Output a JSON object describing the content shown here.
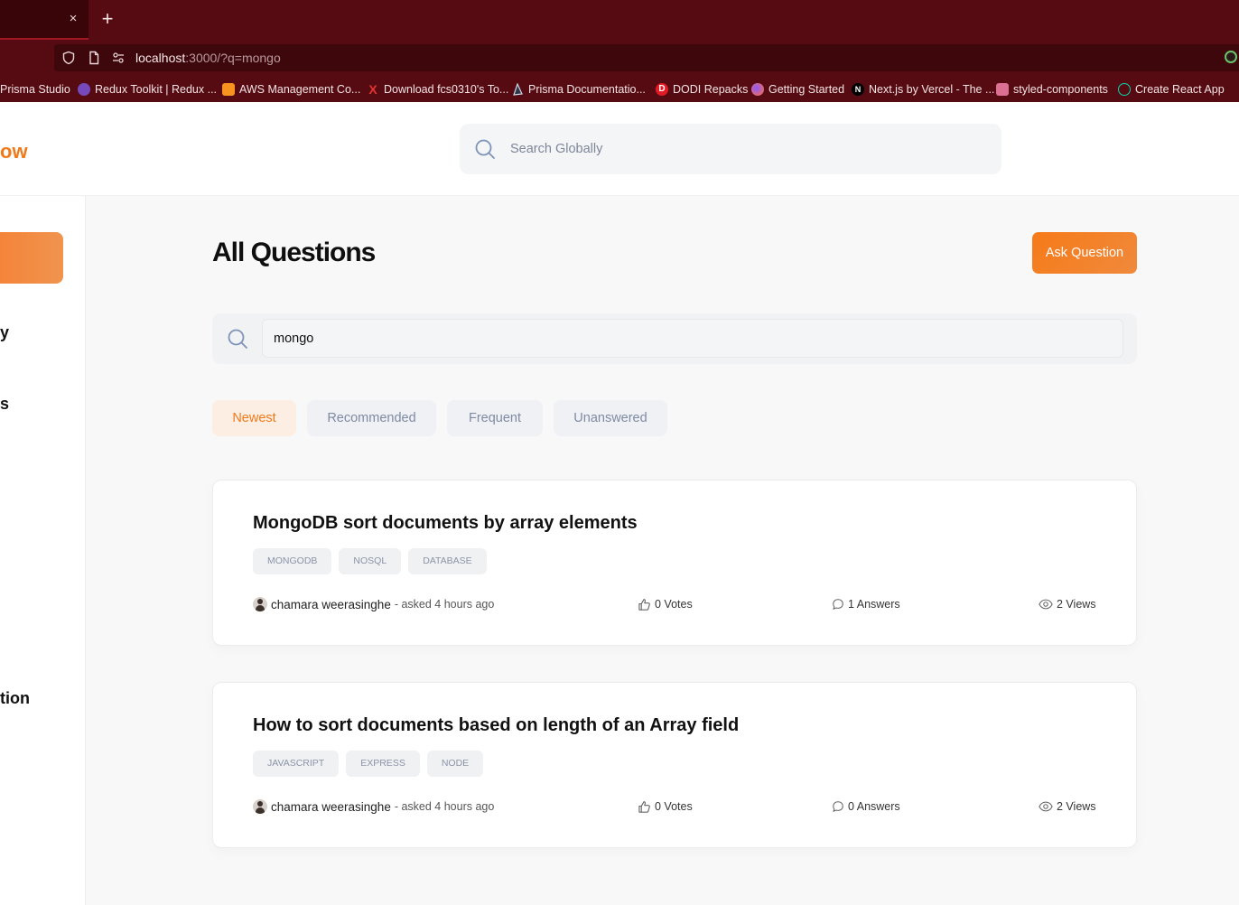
{
  "browser": {
    "tab_close": "×",
    "new_tab": "+",
    "url_host": "localhost",
    "url_rest": ":3000/?q=mongo",
    "bookmarks": [
      {
        "label": "Prisma Studio",
        "color": "#560b12"
      },
      {
        "label": "Redux Toolkit | Redux ...",
        "color": "#764abc"
      },
      {
        "label": "AWS Management Co...",
        "color": "#f7931e"
      },
      {
        "label": "Download fcs0310's To...",
        "color": "#e3342f"
      },
      {
        "label": "Prisma Documentatio...",
        "color": "#cfd6e4"
      },
      {
        "label": "DODI Repacks",
        "color": "#e01b24"
      },
      {
        "label": "Getting Started",
        "color": "#ff7139"
      },
      {
        "label": "Next.js by Vercel - The ...",
        "color": "#000000"
      },
      {
        "label": "styled-components",
        "color": "#db7093"
      },
      {
        "label": "Create React App",
        "color": "#09d3ac"
      }
    ]
  },
  "header": {
    "logo_fragment": "ow",
    "search_placeholder": "Search Globally"
  },
  "sidebar": {
    "fragments": [
      "y",
      "s",
      "tion"
    ]
  },
  "main": {
    "title": "All Questions",
    "ask_button": "Ask Question",
    "search_value": "mongo",
    "filters": [
      {
        "label": "Newest",
        "active": true
      },
      {
        "label": "Recommended",
        "active": false
      },
      {
        "label": "Frequent",
        "active": false
      },
      {
        "label": "Unanswered",
        "active": false
      }
    ]
  },
  "questions": [
    {
      "title": "MongoDB sort documents by array elements",
      "tags": [
        "MONGODB",
        "NOSQL",
        "DATABASE"
      ],
      "author": "chamara weerasinghe",
      "asked": "- asked 4 hours ago",
      "votes": "0 Votes",
      "answers": "1 Answers",
      "views": "2 Views"
    },
    {
      "title": "How to sort documents based on length of an Array field",
      "tags": [
        "JAVASCRIPT",
        "EXPRESS",
        "NODE"
      ],
      "author": "chamara weerasinghe",
      "asked": "- asked 4 hours ago",
      "votes": "0 Votes",
      "answers": "0 Answers",
      "views": "2 Views"
    }
  ],
  "colors": {
    "accent": "#f07a1a",
    "browser_chrome": "#560b12"
  }
}
